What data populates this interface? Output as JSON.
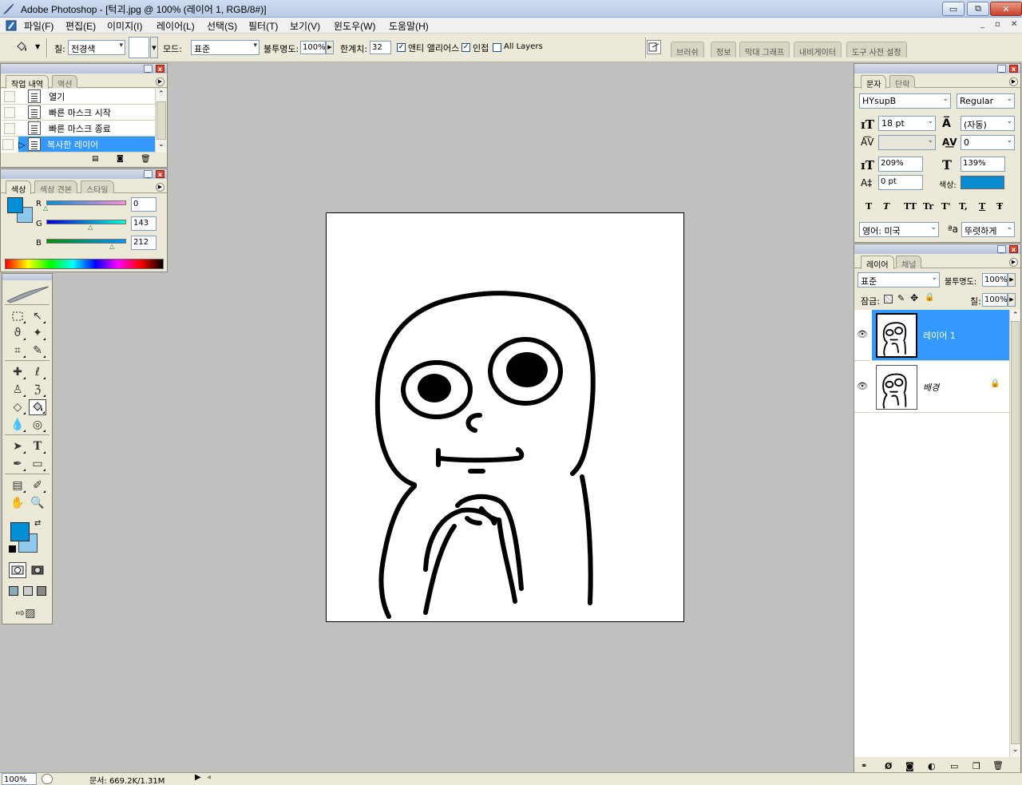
{
  "window": {
    "title": "Adobe Photoshop - [턱괴.jpg @ 100% (레이어 1, RGB/8#)]",
    "minimize_label": "▭",
    "maximize_label": "⧉",
    "close_label": "✕"
  },
  "menu": {
    "items": [
      "파일(F)",
      "편집(E)",
      "이미지(I)",
      "레이어(L)",
      "선택(S)",
      "필터(T)",
      "보기(V)",
      "윈도우(W)",
      "도움말(H)"
    ],
    "mdi_min": "_",
    "mdi_restore": "▫",
    "mdi_close": "✕"
  },
  "options": {
    "fill_label": "칠:",
    "fill_value": "전경색",
    "pattern_label": "",
    "mode_label": "모드:",
    "mode_value": "표준",
    "opacity_label": "불투명도:",
    "opacity_value": "100%",
    "tolerance_label": "한계치:",
    "tolerance_value": "32",
    "antialias_label": "앤티 앨리어스",
    "antialias_checked": true,
    "contiguous_label": "인접",
    "contiguous_checked": true,
    "all_layers_label": "All Layers",
    "all_layers_checked": false,
    "well_tabs": [
      "브러쉬",
      "정보",
      "막대 그래프",
      "내비게이터",
      "도구 사전 설정"
    ]
  },
  "history_panel": {
    "tabs": [
      "작업 내역",
      "액션"
    ],
    "items": [
      {
        "label": "열기",
        "selected": false
      },
      {
        "label": "빠른 마스크 시작",
        "selected": false
      },
      {
        "label": "빠른 마스크 종료",
        "selected": false
      },
      {
        "label": "복사한 레이어",
        "selected": true
      }
    ]
  },
  "color_panel": {
    "tabs": [
      "색상",
      "색상 견본",
      "스타일"
    ],
    "channels": [
      {
        "name": "R",
        "value": "0",
        "level": 0.0
      },
      {
        "name": "G",
        "value": "143",
        "level": 0.561
      },
      {
        "name": "B",
        "value": "212",
        "level": 0.831
      }
    ],
    "foreground": "#008fd4",
    "background": "#8ec8ec"
  },
  "character_panel": {
    "tabs": [
      "문자",
      "단락"
    ],
    "font_family": "HYsupB",
    "font_style": "Regular",
    "size": "18 pt",
    "leading": "(자동)",
    "kerning": "",
    "tracking": "0",
    "vertical_scale": "209%",
    "horizontal_scale": "139%",
    "baseline_shift": "0 pt",
    "color_label": "색상:",
    "color": "#0a8bd0",
    "style_buttons": [
      "T",
      "T",
      "TT",
      "Tr",
      "T'",
      "T,",
      "T",
      "Ŧ"
    ],
    "language": "영어: 미국",
    "antialias_icon": "ªa",
    "antialias": "뚜렷하게"
  },
  "layers_panel": {
    "tabs": [
      "레이어",
      "채널"
    ],
    "blend_mode": "표준",
    "opacity_label": "불투명도:",
    "opacity": "100%",
    "lock_label": "잠금:",
    "fill_label": "칠:",
    "fill": "100%",
    "layers": [
      {
        "name": "레이어 1",
        "selected": true,
        "locked": false
      },
      {
        "name": "배경",
        "selected": false,
        "locked": true
      }
    ]
  },
  "status": {
    "zoom": "100%",
    "doc_info": "문서: 669.2K/1.31M"
  },
  "canvas": {
    "background": "#ffffff"
  }
}
